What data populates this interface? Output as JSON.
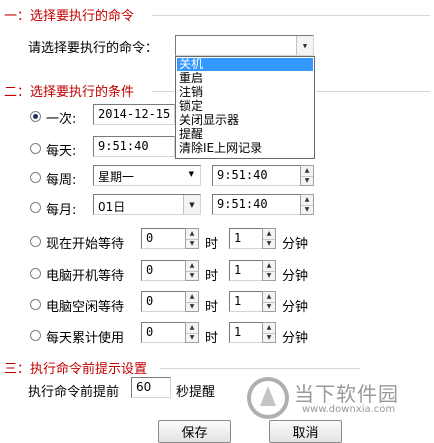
{
  "sections": {
    "command": "一：选择要执行的命令",
    "condition": "二：选择要执行的条件",
    "prompt": "三：执行命令前提示设置"
  },
  "command": {
    "label": "请选择要执行的命令：",
    "selected": "",
    "options": [
      "关机",
      "重启",
      "注销",
      "锁定",
      "关闭显示器",
      "提醒",
      "清除IE上网记录"
    ],
    "highlighted_index": 0
  },
  "conditions": {
    "once": {
      "label": "一次:",
      "date": "2014-12-15",
      "checked": true
    },
    "daily": {
      "label": "每天:",
      "time": "9:51:40"
    },
    "weekly": {
      "label": "每周:",
      "day": "星期一",
      "time": "9:51:40"
    },
    "monthly": {
      "label": "每月:",
      "day": "01日",
      "time": "9:51:40"
    },
    "from_now": {
      "label": "现在开始等待",
      "hours": "0",
      "minutes": "1"
    },
    "after_boot": {
      "label": "电脑开机等待",
      "hours": "0",
      "minutes": "1"
    },
    "idle": {
      "label": "电脑空闲等待",
      "hours": "0",
      "minutes": "1"
    },
    "daily_usage": {
      "label": "每天累计使用",
      "hours": "0",
      "minutes": "1"
    },
    "hour_unit": "时",
    "minute_unit": "分钟"
  },
  "prompt": {
    "before_label": "执行命令前提前",
    "seconds": "60",
    "after_label": "秒提醒"
  },
  "buttons": {
    "save": "保存",
    "cancel": "取消"
  },
  "watermark": {
    "brand": "当下软件园",
    "url": "www.downxia.com"
  },
  "colors": {
    "section_title": "#c00000",
    "selection": "#3399ff"
  }
}
